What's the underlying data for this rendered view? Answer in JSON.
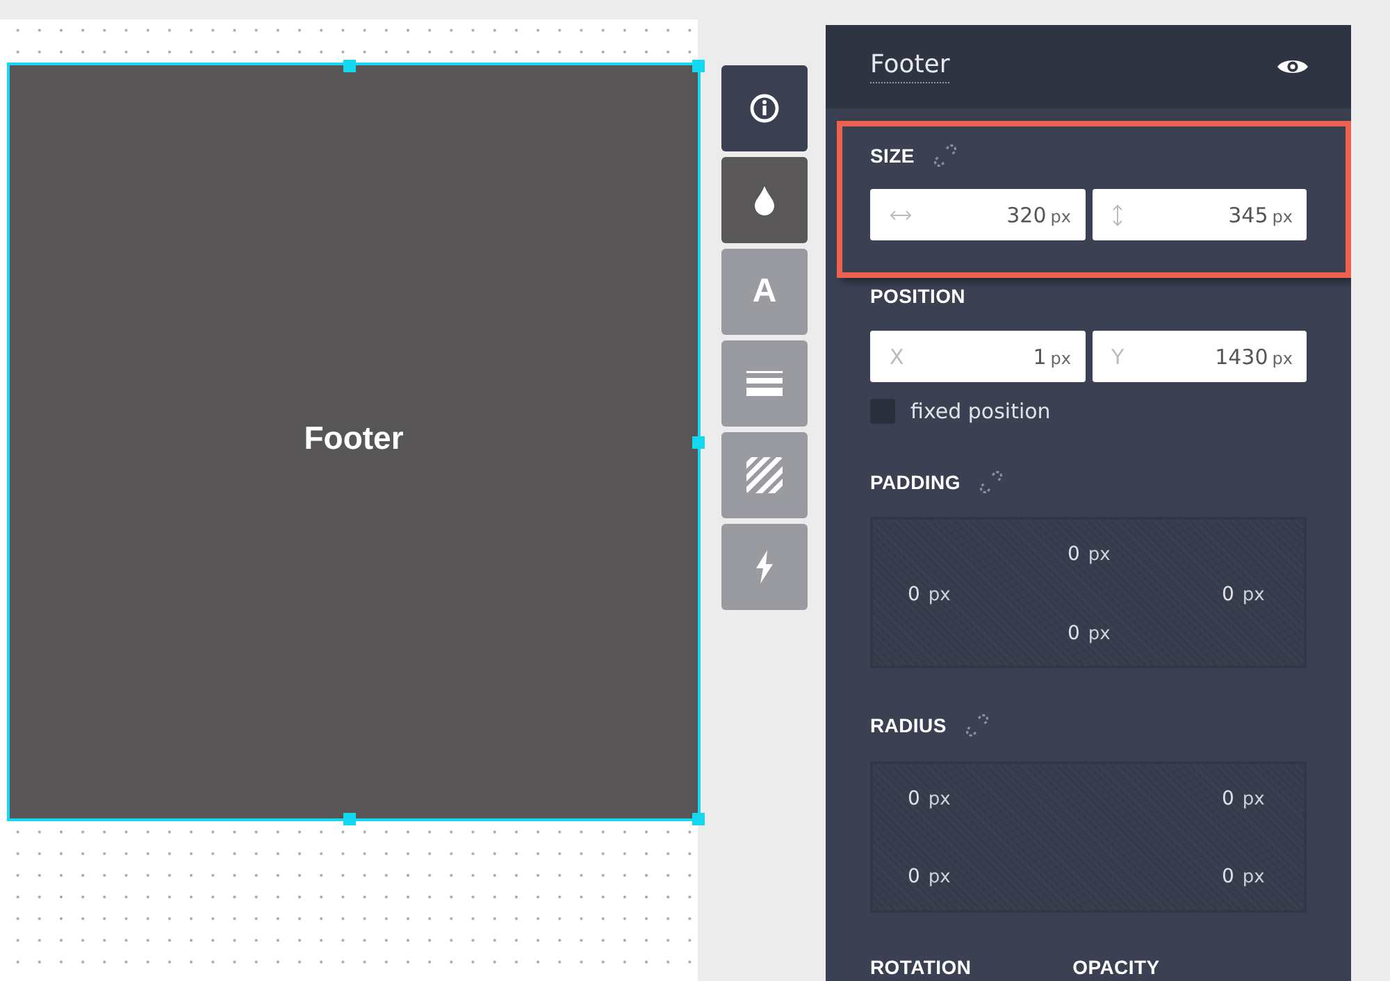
{
  "canvas": {
    "element": {
      "label": "Footer",
      "selected": true
    }
  },
  "tools": [
    {
      "kind": "info",
      "selected": true,
      "highlighted": false
    },
    {
      "kind": "fill",
      "selected": false,
      "highlighted": true
    },
    {
      "kind": "text",
      "label": "A",
      "selected": false,
      "highlighted": false
    },
    {
      "kind": "lines",
      "selected": false,
      "highlighted": false
    },
    {
      "kind": "stripes",
      "selected": false,
      "highlighted": false
    },
    {
      "kind": "bolt",
      "selected": false,
      "highlighted": false
    }
  ],
  "panel": {
    "title": "Footer",
    "visible": true,
    "size": {
      "label": "SIZE",
      "highlighted": true,
      "width": {
        "value": "320",
        "unit": "px"
      },
      "height": {
        "value": "345",
        "unit": "px"
      }
    },
    "position": {
      "label": "POSITION",
      "x": {
        "label": "X",
        "value": "1",
        "unit": "px"
      },
      "y": {
        "label": "Y",
        "value": "1430",
        "unit": "px"
      },
      "fixed": {
        "label": "fixed position",
        "checked": false
      }
    },
    "padding": {
      "label": "PADDING",
      "top": {
        "value": "0",
        "unit": "px"
      },
      "left": {
        "value": "0",
        "unit": "px"
      },
      "right": {
        "value": "0",
        "unit": "px"
      },
      "bottom": {
        "value": "0",
        "unit": "px"
      }
    },
    "radius": {
      "label": "RADIUS",
      "top_left": {
        "value": "0",
        "unit": "px"
      },
      "top_right": {
        "value": "0",
        "unit": "px"
      },
      "bottom_left": {
        "value": "0",
        "unit": "px"
      },
      "bottom_right": {
        "value": "0",
        "unit": "px"
      }
    },
    "more": [
      {
        "label": "ROTATION"
      },
      {
        "label": "OPACITY"
      }
    ]
  }
}
